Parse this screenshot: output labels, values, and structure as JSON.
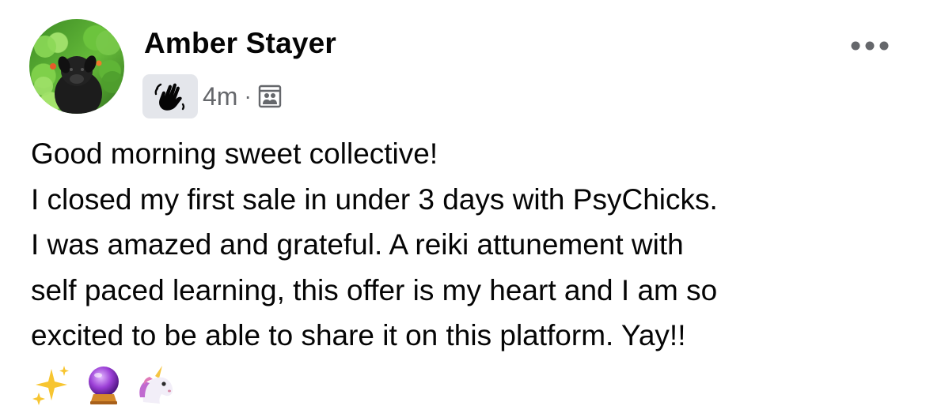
{
  "post": {
    "author": {
      "name": "Amber Stayer"
    },
    "meta": {
      "badge_icon": "waving-hand-icon",
      "timestamp": "4m",
      "separator": "·",
      "audience_icon": "group-audience-icon"
    },
    "more_icon": "more-options-icon",
    "text_lines": [
      "Good morning sweet collective!",
      "I closed my first sale in under 3 days with PsyChicks.",
      "I was amazed and grateful. A reiki attunement with",
      "self paced learning, this offer is my heart and I am so",
      "excited to be able to share it on this platform. Yay!!"
    ],
    "emojis": [
      "sparkles",
      "crystal-ball",
      "unicorn"
    ],
    "colors": {
      "text": "#050505",
      "secondary": "#65676b",
      "badge_bg": "#e4e6eb",
      "background": "#ffffff"
    }
  }
}
